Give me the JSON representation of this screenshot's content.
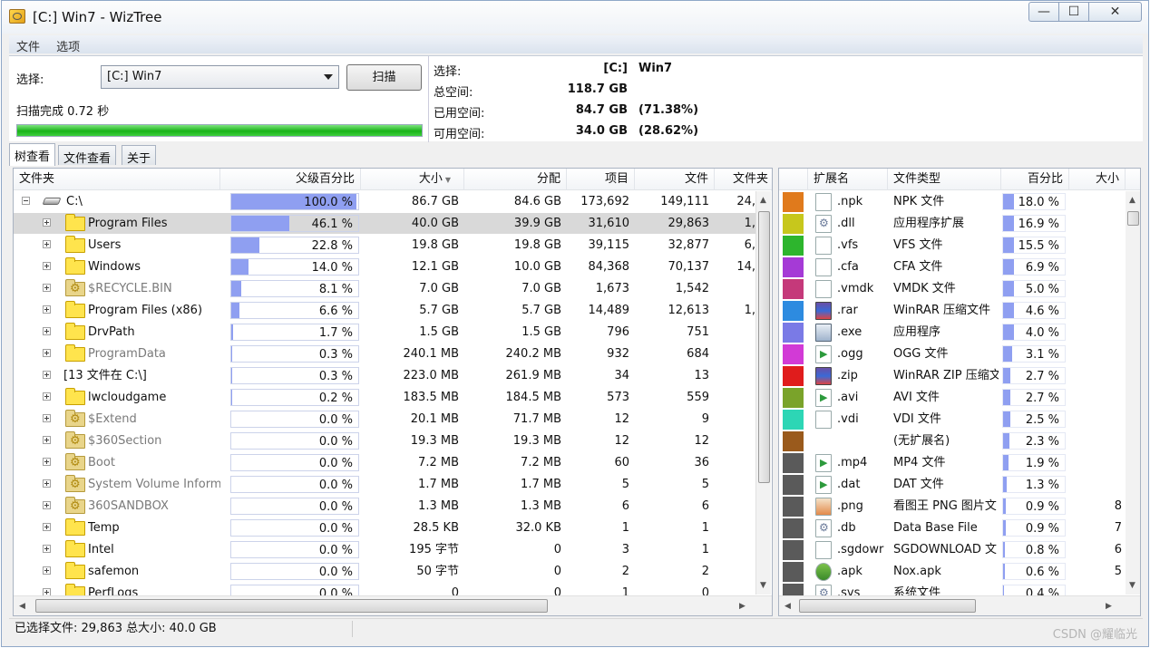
{
  "window": {
    "title": "[C:] Win7  - WizTree",
    "min_glyph": "—",
    "max_glyph": "☐",
    "close_glyph": "✕"
  },
  "menu": [
    "文件",
    "选项"
  ],
  "scan_panel": {
    "select_label": "选择:",
    "drive_value": "[C:] Win7",
    "scan_button": "扫描",
    "status": "扫描完成 0.72 秒",
    "progress": 1.0
  },
  "drive_info": {
    "rows": [
      {
        "k": "选择:",
        "v": "[C:]",
        "p": "Win7"
      },
      {
        "k": "总空间:",
        "v": "118.7 GB",
        "p": ""
      },
      {
        "k": "已用空间:",
        "v": "84.7 GB",
        "p": "(71.38%)"
      },
      {
        "k": "可用空间:",
        "v": "34.0 GB",
        "p": "(28.62%)"
      }
    ]
  },
  "tabs": [
    "树查看",
    "文件查看",
    "关于"
  ],
  "tree": {
    "headers": [
      "文件夹",
      "父级百分比",
      "大小",
      "分配",
      "项目",
      "文件",
      "文件夹"
    ],
    "sort_indicator": "▼",
    "rows": [
      {
        "name": "C:\\",
        "pct": "100.0 %",
        "pct_value": 100.0,
        "size": "86.7 GB",
        "alloc": "84.6 GB",
        "items": "173,692",
        "files": "149,111",
        "folders": "24,",
        "kind": "drive",
        "gray": false
      },
      {
        "name": "Program Files",
        "pct": "46.1 %",
        "pct_value": 46.1,
        "size": "40.0 GB",
        "alloc": "39.9 GB",
        "items": "31,610",
        "files": "29,863",
        "folders": "1,",
        "kind": "folder",
        "gray": false,
        "selected": true
      },
      {
        "name": "Users",
        "pct": "22.8 %",
        "pct_value": 22.8,
        "size": "19.8 GB",
        "alloc": "19.8 GB",
        "items": "39,115",
        "files": "32,877",
        "folders": "6,",
        "kind": "folder",
        "gray": false
      },
      {
        "name": "Windows",
        "pct": "14.0 %",
        "pct_value": 14.0,
        "size": "12.1 GB",
        "alloc": "10.0 GB",
        "items": "84,368",
        "files": "70,137",
        "folders": "14,",
        "kind": "folder",
        "gray": false
      },
      {
        "name": "$RECYCLE.BIN",
        "pct": "8.1 %",
        "pct_value": 8.1,
        "size": "7.0 GB",
        "alloc": "7.0 GB",
        "items": "1,673",
        "files": "1,542",
        "folders": "",
        "kind": "sys",
        "gray": true
      },
      {
        "name": "Program Files (x86)",
        "pct": "6.6 %",
        "pct_value": 6.6,
        "size": "5.7 GB",
        "alloc": "5.7 GB",
        "items": "14,489",
        "files": "12,613",
        "folders": "1,",
        "kind": "folder",
        "gray": false
      },
      {
        "name": "DrvPath",
        "pct": "1.7 %",
        "pct_value": 1.7,
        "size": "1.5 GB",
        "alloc": "1.5 GB",
        "items": "796",
        "files": "751",
        "folders": "",
        "kind": "folder",
        "gray": false
      },
      {
        "name": "ProgramData",
        "pct": "0.3 %",
        "pct_value": 0.3,
        "size": "240.1 MB",
        "alloc": "240.2 MB",
        "items": "932",
        "files": "684",
        "folders": "",
        "kind": "folder",
        "gray": true
      },
      {
        "name": "[13 文件在 C:\\]",
        "pct": "0.3 %",
        "pct_value": 0.3,
        "size": "223.0 MB",
        "alloc": "261.9 MB",
        "items": "34",
        "files": "13",
        "folders": "",
        "kind": "none",
        "gray": false
      },
      {
        "name": "lwcloudgame",
        "pct": "0.2 %",
        "pct_value": 0.2,
        "size": "183.5 MB",
        "alloc": "184.5 MB",
        "items": "573",
        "files": "559",
        "folders": "",
        "kind": "folder",
        "gray": false
      },
      {
        "name": "$Extend",
        "pct": "0.0 %",
        "pct_value": 0.0,
        "size": "20.1 MB",
        "alloc": "71.7 MB",
        "items": "12",
        "files": "9",
        "folders": "",
        "kind": "sys",
        "gray": true
      },
      {
        "name": "$360Section",
        "pct": "0.0 %",
        "pct_value": 0.0,
        "size": "19.3 MB",
        "alloc": "19.3 MB",
        "items": "12",
        "files": "12",
        "folders": "",
        "kind": "sys",
        "gray": true
      },
      {
        "name": "Boot",
        "pct": "0.0 %",
        "pct_value": 0.0,
        "size": "7.2 MB",
        "alloc": "7.2 MB",
        "items": "60",
        "files": "36",
        "folders": "",
        "kind": "sys",
        "gray": true
      },
      {
        "name": "System Volume Inform",
        "pct": "0.0 %",
        "pct_value": 0.0,
        "size": "1.7 MB",
        "alloc": "1.7 MB",
        "items": "5",
        "files": "5",
        "folders": "",
        "kind": "sys",
        "gray": true
      },
      {
        "name": "360SANDBOX",
        "pct": "0.0 %",
        "pct_value": 0.0,
        "size": "1.3 MB",
        "alloc": "1.3 MB",
        "items": "6",
        "files": "6",
        "folders": "",
        "kind": "sys",
        "gray": true
      },
      {
        "name": "Temp",
        "pct": "0.0 %",
        "pct_value": 0.0,
        "size": "28.5 KB",
        "alloc": "32.0 KB",
        "items": "1",
        "files": "1",
        "folders": "",
        "kind": "folder",
        "gray": false
      },
      {
        "name": "Intel",
        "pct": "0.0 %",
        "pct_value": 0.0,
        "size": "195 字节",
        "alloc": "0",
        "items": "3",
        "files": "1",
        "folders": "",
        "kind": "folder",
        "gray": false
      },
      {
        "name": "safemon",
        "pct": "0.0 %",
        "pct_value": 0.0,
        "size": "50 字节",
        "alloc": "0",
        "items": "2",
        "files": "2",
        "folders": "",
        "kind": "folder",
        "gray": false
      },
      {
        "name": "PerfLogs",
        "pct": "0.0 %",
        "pct_value": 0.0,
        "size": "0",
        "alloc": "0",
        "items": "1",
        "files": "0",
        "folders": "",
        "kind": "folder",
        "gray": false
      }
    ]
  },
  "ext": {
    "headers": [
      "",
      "扩展名",
      "文件类型",
      "百分比",
      "大小"
    ],
    "rows": [
      {
        "color": "#e07a1c",
        "icon": "doc",
        "ext": ".npk",
        "type": "NPK 文件",
        "pct": "18.0 %",
        "pct_value": 18.0,
        "size": ""
      },
      {
        "color": "#c7c71c",
        "icon": "gear",
        "ext": ".dll",
        "type": "应用程序扩展",
        "pct": "16.9 %",
        "pct_value": 16.9,
        "size": ""
      },
      {
        "color": "#2db52d",
        "icon": "doc",
        "ext": ".vfs",
        "type": "VFS 文件",
        "pct": "15.5 %",
        "pct_value": 15.5,
        "size": ""
      },
      {
        "color": "#a53ad6",
        "icon": "cfa",
        "ext": ".cfa",
        "type": "CFA 文件",
        "pct": "6.9 %",
        "pct_value": 6.9,
        "size": ""
      },
      {
        "color": "#c5397a",
        "icon": "doc",
        "ext": ".vmdk",
        "type": "VMDK 文件",
        "pct": "5.0 %",
        "pct_value": 5.0,
        "size": ""
      },
      {
        "color": "#2d8be0",
        "icon": "arch",
        "ext": ".rar",
        "type": "WinRAR 压缩文件",
        "pct": "4.6 %",
        "pct_value": 4.6,
        "size": ""
      },
      {
        "color": "#7a7ae6",
        "icon": "exe",
        "ext": ".exe",
        "type": "应用程序",
        "pct": "4.0 %",
        "pct_value": 4.0,
        "size": ""
      },
      {
        "color": "#d23ad6",
        "icon": "media",
        "ext": ".ogg",
        "type": "OGG 文件",
        "pct": "3.1 %",
        "pct_value": 3.1,
        "size": ""
      },
      {
        "color": "#e01c1c",
        "icon": "arch",
        "ext": ".zip",
        "type": "WinRAR ZIP 压缩文",
        "pct": "2.7 %",
        "pct_value": 2.7,
        "size": ""
      },
      {
        "color": "#7aa32a",
        "icon": "media",
        "ext": ".avi",
        "type": "AVI 文件",
        "pct": "2.7 %",
        "pct_value": 2.7,
        "size": ""
      },
      {
        "color": "#2dd6b5",
        "icon": "doc",
        "ext": ".vdi",
        "type": "VDI 文件",
        "pct": "2.5 %",
        "pct_value": 2.5,
        "size": ""
      },
      {
        "color": "#9a5a1c",
        "icon": "none",
        "ext": "",
        "type": "(无扩展名)",
        "pct": "2.3 %",
        "pct_value": 2.3,
        "size": ""
      },
      {
        "color": "#5a5a5a",
        "icon": "media",
        "ext": ".mp4",
        "type": "MP4 文件",
        "pct": "1.9 %",
        "pct_value": 1.9,
        "size": ""
      },
      {
        "color": "#5a5a5a",
        "icon": "media",
        "ext": ".dat",
        "type": "DAT 文件",
        "pct": "1.3 %",
        "pct_value": 1.3,
        "size": ""
      },
      {
        "color": "#5a5a5a",
        "icon": "img",
        "ext": ".png",
        "type": "看图王 PNG 图片文",
        "pct": "0.9 %",
        "pct_value": 0.9,
        "size": "8"
      },
      {
        "color": "#5a5a5a",
        "icon": "gear",
        "ext": ".db",
        "type": "Data Base File",
        "pct": "0.9 %",
        "pct_value": 0.9,
        "size": "7"
      },
      {
        "color": "#5a5a5a",
        "icon": "doc",
        "ext": ".sgdowr",
        "type": "SGDOWNLOAD 文",
        "pct": "0.8 %",
        "pct_value": 0.8,
        "size": "6"
      },
      {
        "color": "#5a5a5a",
        "icon": "apk",
        "ext": ".apk",
        "type": "Nox.apk",
        "pct": "0.6 %",
        "pct_value": 0.6,
        "size": "5"
      },
      {
        "color": "#5a5a5a",
        "icon": "gear",
        "ext": ".sys",
        "type": "系统文件",
        "pct": "0.4 %",
        "pct_value": 0.4,
        "size": ""
      }
    ]
  },
  "statusbar": {
    "text": "已选择文件: 29,863  总大小: 40.0 GB"
  },
  "watermark": "CSDN @耀临光"
}
